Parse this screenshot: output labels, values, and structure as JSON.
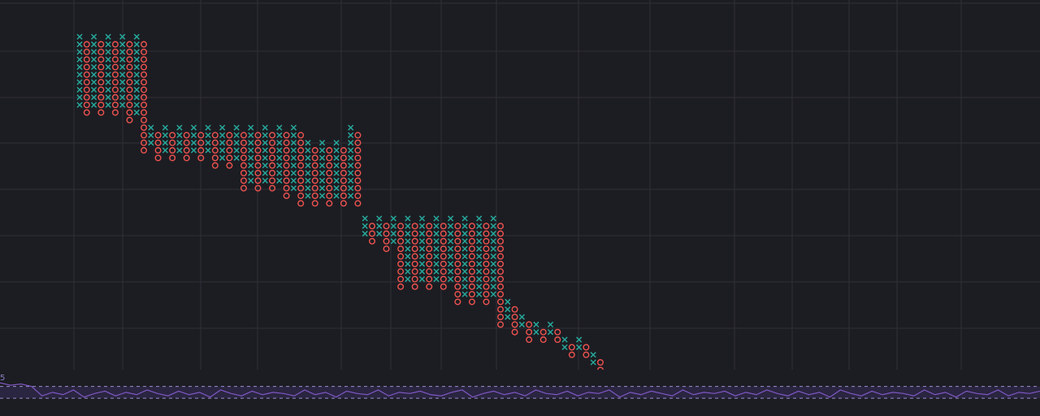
{
  "chart_data": {
    "type": "point-and-figure",
    "box_size": 1,
    "column_count": 74,
    "columns": [
      {
        "kind": "X",
        "low": 53,
        "high": 62
      },
      {
        "kind": "O",
        "low": 52,
        "high": 61
      },
      {
        "kind": "X",
        "low": 53,
        "high": 62
      },
      {
        "kind": "O",
        "low": 52,
        "high": 61
      },
      {
        "kind": "X",
        "low": 53,
        "high": 62
      },
      {
        "kind": "O",
        "low": 52,
        "high": 61
      },
      {
        "kind": "X",
        "low": 53,
        "high": 62
      },
      {
        "kind": "O",
        "low": 51,
        "high": 61
      },
      {
        "kind": "X",
        "low": 52,
        "high": 62
      },
      {
        "kind": "O",
        "low": 47,
        "high": 61
      },
      {
        "kind": "X",
        "low": 48,
        "high": 50
      },
      {
        "kind": "O",
        "low": 46,
        "high": 49
      },
      {
        "kind": "X",
        "low": 47,
        "high": 50
      },
      {
        "kind": "O",
        "low": 46,
        "high": 49
      },
      {
        "kind": "X",
        "low": 47,
        "high": 50
      },
      {
        "kind": "O",
        "low": 46,
        "high": 49
      },
      {
        "kind": "X",
        "low": 47,
        "high": 50
      },
      {
        "kind": "O",
        "low": 46,
        "high": 49
      },
      {
        "kind": "X",
        "low": 47,
        "high": 50
      },
      {
        "kind": "O",
        "low": 45,
        "high": 49
      },
      {
        "kind": "X",
        "low": 46,
        "high": 50
      },
      {
        "kind": "O",
        "low": 45,
        "high": 49
      },
      {
        "kind": "X",
        "low": 46,
        "high": 50
      },
      {
        "kind": "O",
        "low": 42,
        "high": 49
      },
      {
        "kind": "X",
        "low": 43,
        "high": 50
      },
      {
        "kind": "O",
        "low": 42,
        "high": 49
      },
      {
        "kind": "X",
        "low": 43,
        "high": 50
      },
      {
        "kind": "O",
        "low": 42,
        "high": 49
      },
      {
        "kind": "X",
        "low": 43,
        "high": 50
      },
      {
        "kind": "O",
        "low": 41,
        "high": 49
      },
      {
        "kind": "X",
        "low": 42,
        "high": 50
      },
      {
        "kind": "O",
        "low": 40,
        "high": 49
      },
      {
        "kind": "X",
        "low": 41,
        "high": 48
      },
      {
        "kind": "O",
        "low": 40,
        "high": 47
      },
      {
        "kind": "X",
        "low": 41,
        "high": 48
      },
      {
        "kind": "O",
        "low": 40,
        "high": 47
      },
      {
        "kind": "X",
        "low": 41,
        "high": 48
      },
      {
        "kind": "O",
        "low": 40,
        "high": 47
      },
      {
        "kind": "X",
        "low": 41,
        "high": 50
      },
      {
        "kind": "O",
        "low": 40,
        "high": 49
      },
      {
        "kind": "X",
        "low": 36,
        "high": 38
      },
      {
        "kind": "O",
        "low": 35,
        "high": 37
      },
      {
        "kind": "X",
        "low": 36,
        "high": 38
      },
      {
        "kind": "O",
        "low": 34,
        "high": 37
      },
      {
        "kind": "X",
        "low": 35,
        "high": 38
      },
      {
        "kind": "O",
        "low": 29,
        "high": 37
      },
      {
        "kind": "X",
        "low": 30,
        "high": 38
      },
      {
        "kind": "O",
        "low": 29,
        "high": 37
      },
      {
        "kind": "X",
        "low": 30,
        "high": 38
      },
      {
        "kind": "O",
        "low": 29,
        "high": 37
      },
      {
        "kind": "X",
        "low": 30,
        "high": 38
      },
      {
        "kind": "O",
        "low": 29,
        "high": 37
      },
      {
        "kind": "X",
        "low": 30,
        "high": 38
      },
      {
        "kind": "O",
        "low": 27,
        "high": 37
      },
      {
        "kind": "X",
        "low": 28,
        "high": 38
      },
      {
        "kind": "O",
        "low": 27,
        "high": 37
      },
      {
        "kind": "X",
        "low": 28,
        "high": 38
      },
      {
        "kind": "O",
        "low": 27,
        "high": 37
      },
      {
        "kind": "X",
        "low": 28,
        "high": 38
      },
      {
        "kind": "O",
        "low": 24,
        "high": 37
      },
      {
        "kind": "X",
        "low": 25,
        "high": 27
      },
      {
        "kind": "O",
        "low": 23,
        "high": 26
      },
      {
        "kind": "X",
        "low": 24,
        "high": 25
      },
      {
        "kind": "O",
        "low": 22,
        "high": 24
      },
      {
        "kind": "X",
        "low": 23,
        "high": 24
      },
      {
        "kind": "O",
        "low": 22,
        "high": 23
      },
      {
        "kind": "X",
        "low": 23,
        "high": 24
      },
      {
        "kind": "O",
        "low": 22,
        "high": 23
      },
      {
        "kind": "X",
        "low": 21,
        "high": 22
      },
      {
        "kind": "O",
        "low": 20,
        "high": 21
      },
      {
        "kind": "X",
        "low": 21,
        "high": 22
      },
      {
        "kind": "O",
        "low": 20,
        "high": 21
      },
      {
        "kind": "X",
        "low": 19,
        "high": 20
      },
      {
        "kind": "O",
        "low": 18,
        "high": 19
      }
    ],
    "indicator_pane": {
      "label": "5",
      "band": [
        45,
        55
      ],
      "values": [
        58,
        56,
        57,
        55,
        47,
        50,
        48,
        52,
        46,
        49,
        51,
        47,
        50,
        48,
        52,
        49,
        47,
        51,
        48,
        50,
        46,
        52,
        49,
        47,
        51,
        48,
        50,
        49,
        47,
        52,
        48,
        50,
        46,
        51,
        49,
        48,
        52,
        47,
        50,
        49,
        51,
        48,
        47,
        50,
        52,
        46,
        49,
        51,
        48,
        50,
        47,
        52,
        49,
        48,
        51,
        47,
        50,
        49,
        52,
        46,
        50,
        48,
        51,
        49,
        47,
        52,
        48,
        50,
        49,
        51,
        47,
        50,
        48,
        52,
        49,
        47,
        51,
        48,
        50,
        46,
        52,
        49,
        47,
        51,
        48,
        50,
        49,
        47,
        52,
        48,
        50,
        46,
        51,
        49,
        48,
        52,
        47,
        50,
        49,
        51
      ]
    },
    "grid": true,
    "colors": {
      "x_mark": "#26a69a",
      "o_mark": "#ef5350",
      "grid": "#2f3038",
      "background": "#1c1d22",
      "pane_fill": "#2a2540",
      "pane_line": "#7e57c2",
      "pane_dash": "#9c8fd0"
    }
  }
}
